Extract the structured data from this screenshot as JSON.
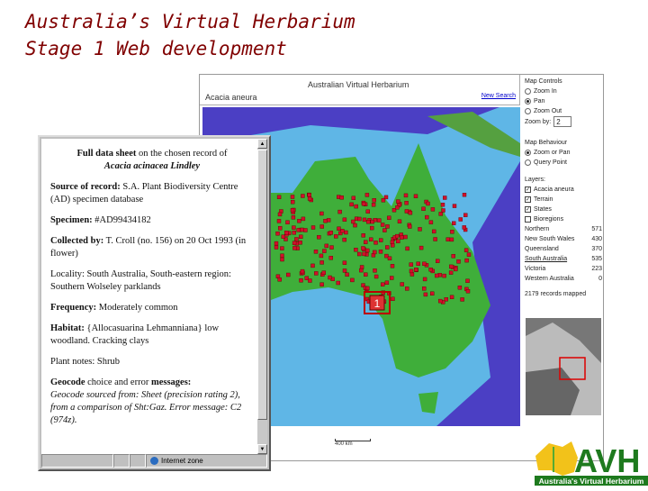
{
  "slide": {
    "title_line1": "Australia’s Virtual Herbarium",
    "title_line2": "Stage 1 Web development"
  },
  "app": {
    "title": "Australian Virtual Herbarium",
    "species": "Acacia aneura",
    "new_search": "New Search",
    "scale_label": "400 km"
  },
  "map_controls": {
    "heading": "Map Controls",
    "options": [
      {
        "label": "Zoom In",
        "selected": false
      },
      {
        "label": "Pan",
        "selected": true
      },
      {
        "label": "Zoom Out",
        "selected": false
      }
    ],
    "zoom_by_label": "Zoom by:",
    "zoom_by_value": "2"
  },
  "map_behaviour": {
    "heading": "Map Behaviour",
    "options": [
      {
        "label": "Zoom or Pan",
        "selected": true
      },
      {
        "label": "Query Point",
        "selected": false
      }
    ]
  },
  "layers": {
    "heading": "Layers:",
    "items": [
      {
        "label": "Acacia aneura",
        "checked": true
      },
      {
        "label": "Terrain",
        "checked": true
      },
      {
        "label": "States",
        "checked": true
      },
      {
        "label": "Bioregions",
        "checked": false
      }
    ]
  },
  "counts": [
    {
      "state": "Northern",
      "count": "571"
    },
    {
      "state": "New South Wales",
      "count": "430"
    },
    {
      "state": "Queensland",
      "count": "370"
    },
    {
      "state": "South Australia",
      "count": "535"
    },
    {
      "state": "Victoria",
      "count": "223"
    },
    {
      "state": "Western Australia",
      "count": "0"
    }
  ],
  "records_mapped": "2179 records mapped",
  "marker_label": "1",
  "popup": {
    "heading_bold": "Full data sheet",
    "heading_rest": " on the chosen record of",
    "species": "Acacia acinacea Lindley",
    "source_label": "Source of record:",
    "source_value": " S.A. Plant Biodiversity Centre (AD) specimen database",
    "specimen_label": "Specimen:",
    "specimen_value": " #AD99434182",
    "collected_label": "Collected by:",
    "collected_value": " T. Croll (no. 156) on 20 Oct 1993 (in flower)",
    "locality_label": "Locality:",
    "locality_value": " South Australia, South-eastern region: Southern Wolseley parklands",
    "frequency_label": "Frequency:",
    "frequency_value": " Moderately common",
    "habitat_label": "Habitat:",
    "habitat_value": " {Allocasuarina Lehmanniana} low woodland. Cracking clays",
    "notes_label": "Plant notes:",
    "notes_value": " Shrub",
    "geocode_label1": "Geocode",
    "geocode_mid": " choice and error ",
    "geocode_label2": "messages:",
    "geocode_value": "Geocode sourced from: Sheet (precision rating 2), from a comparison of Sht:Gaz. Error message: C2 (974z).",
    "status_zone": "Internet zone"
  },
  "logo": {
    "text": "AVH",
    "tagline": "Australia's Virtual Herbarium"
  },
  "colors": {
    "title": "#800000",
    "ocean": "#4b3fc4",
    "shelf": "#5fb6e6",
    "land": "#3fae3a",
    "dots": "#d0102a",
    "logo_green": "#1e7a1e"
  }
}
